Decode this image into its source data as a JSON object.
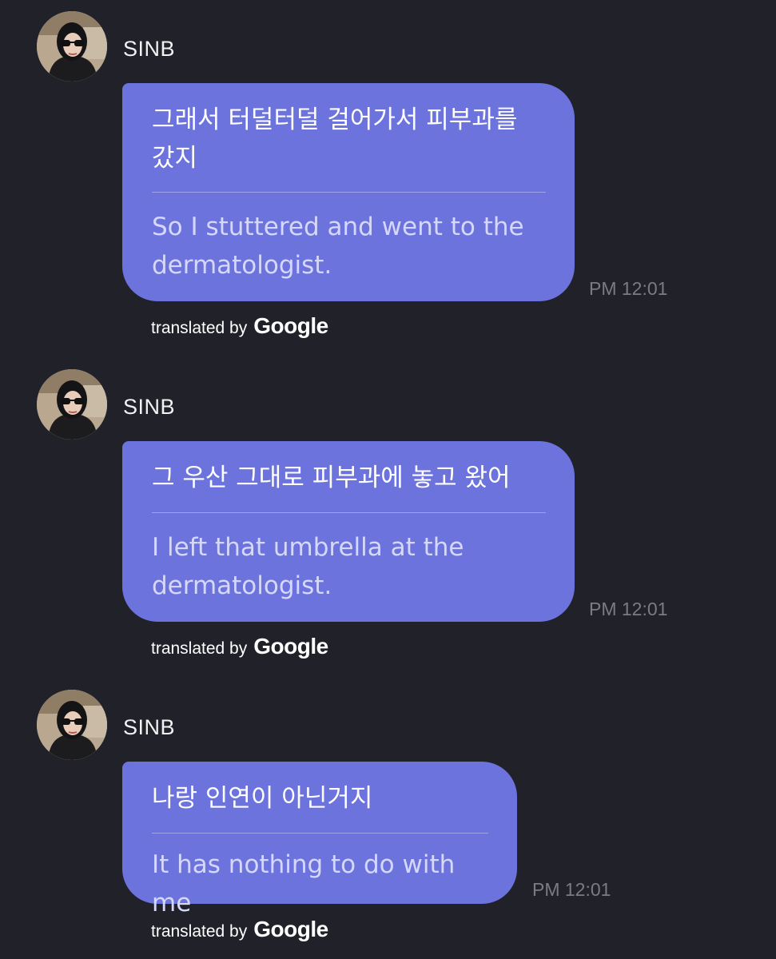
{
  "messages": [
    {
      "sender": "SINB",
      "original": "그래서 터덜터덜 걸어가서 피부과를 갔지",
      "translation": "So I stuttered and went to the dermatologist.",
      "time": "PM 12:01",
      "credit_prefix": "translated by",
      "credit_brand": "Google"
    },
    {
      "sender": "SINB",
      "original": "그 우산 그대로 피부과에 놓고 왔어",
      "translation": "I left that umbrella at the dermatologist.",
      "time": "PM 12:01",
      "credit_prefix": "translated by",
      "credit_brand": "Google"
    },
    {
      "sender": "SINB",
      "original": "나랑 인연이 아닌거지",
      "translation": "It has nothing to do with me",
      "time": "PM 12:01",
      "credit_prefix": "translated by",
      "credit_brand": "Google"
    }
  ],
  "colors": {
    "background": "#21212a",
    "bubble": "#6c73dd",
    "translation_text": "#d5d8fa",
    "timestamp": "#7b7b86"
  }
}
